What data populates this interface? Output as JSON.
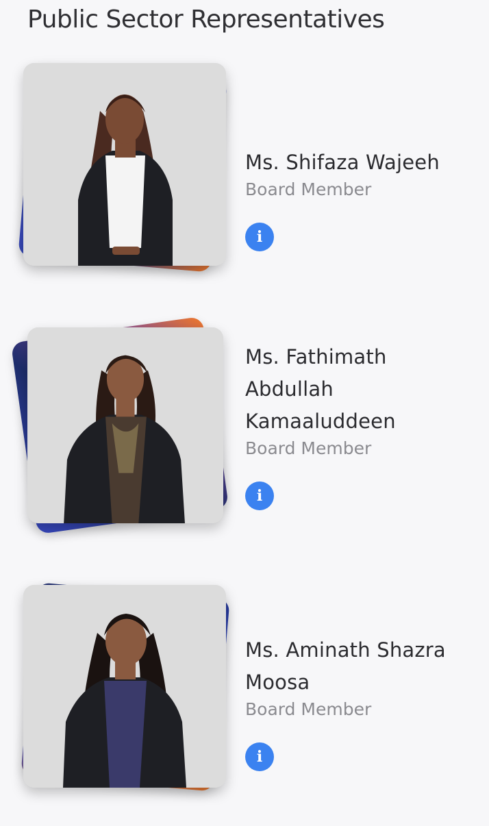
{
  "page": {
    "title": "Public Sector Representatives"
  },
  "members": [
    {
      "name": "Ms. Shifaza Wajeeh",
      "role": "Board Member",
      "info_icon": "i"
    },
    {
      "name": "Ms. Fathimath Abdullah Kamaaluddeen",
      "role": "Board Member",
      "info_icon": "i"
    },
    {
      "name": "Ms. Aminath Shazra Moosa",
      "role": "Board Member",
      "info_icon": "i"
    }
  ],
  "colors": {
    "background": "#f7f7f9",
    "accent_blue": "#3b82f0",
    "frame_navy": "#1d2d6b",
    "frame_blue": "#3848b8",
    "frame_orange": "#f0782a",
    "role_text": "#8a8a8f"
  },
  "icons": {
    "info": "info-icon"
  }
}
